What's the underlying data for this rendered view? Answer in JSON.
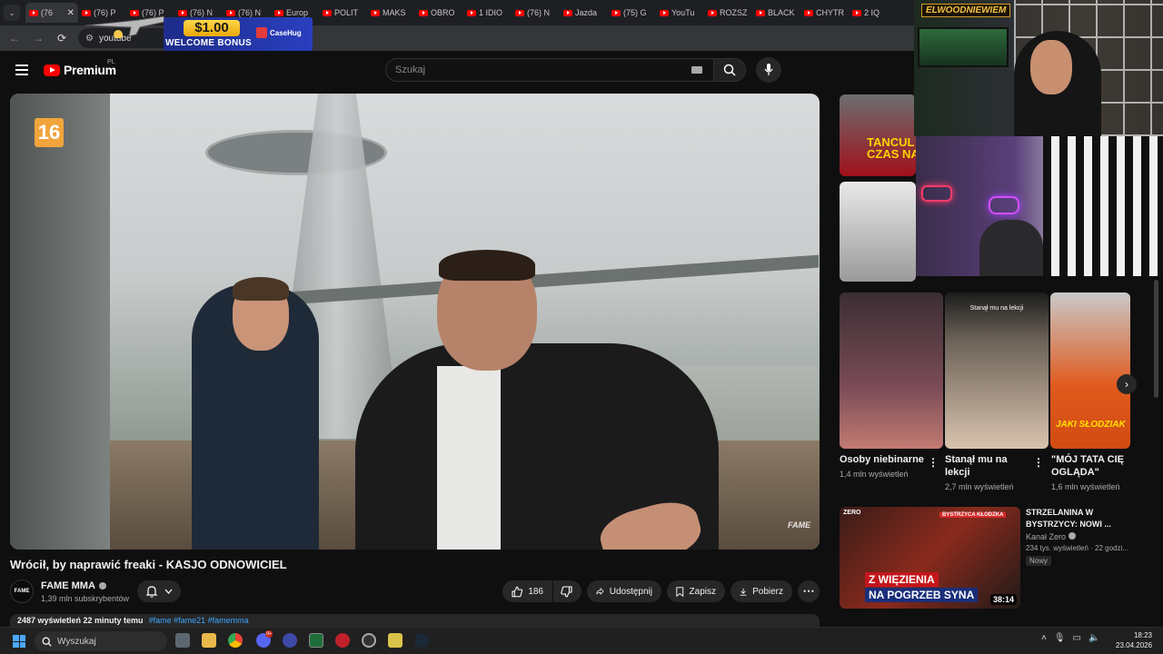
{
  "browser": {
    "tabs": [
      {
        "label": "(76",
        "active": true
      },
      {
        "label": "(76) P"
      },
      {
        "label": "(76) P"
      },
      {
        "label": "(76) N"
      },
      {
        "label": "(76) N"
      },
      {
        "label": "Europ"
      },
      {
        "label": "POLIT"
      },
      {
        "label": "MAKS"
      },
      {
        "label": "OBRO"
      },
      {
        "label": "1 IDIO"
      },
      {
        "label": "(76) N"
      },
      {
        "label": "Jazda"
      },
      {
        "label": "(75) G"
      },
      {
        "label": "YouTu"
      },
      {
        "label": "ROZSZ"
      },
      {
        "label": "BLACK"
      },
      {
        "label": "CHYTR"
      },
      {
        "label": "2 IQ"
      }
    ],
    "close_glyph": "✕",
    "tab_list_glyph": "⌄",
    "address": "youtube"
  },
  "ad": {
    "amount": "$1.00",
    "bonus_text": "WELCOME BONUS",
    "brand": "CaseHug"
  },
  "youtube": {
    "logo_text": "Premium",
    "country_code": "PL",
    "search_placeholder": "Szukaj"
  },
  "video": {
    "age_rating": "16",
    "watermark": "FAME",
    "title": "Wrócił, by naprawić freaki - KASJO ODNOWICIEL",
    "channel_name": "FAME MMA",
    "channel_avatar_text": "FAME",
    "subscribers": "1,39 mln subskrybentów",
    "likes": "186",
    "share_label": "Udostępnij",
    "save_label": "Zapisz",
    "download_label": "Pobierz",
    "views_line": "2487 wyświetleń  22 minuty temu",
    "tags": "#fame #fame21 #famemma"
  },
  "sidebar": {
    "top_thumb_text": "TANCUL\nCZAS NA",
    "shorts": [
      {
        "title": "Osoby niebinarne",
        "views": "1,4 mln wyświetleń",
        "caption": ""
      },
      {
        "title": "Stanął mu na lekcji",
        "views": "2,7 mln wyświetleń",
        "caption": "Stanął mu na lekcji"
      },
      {
        "title": "\"MÓJ TATA CIĘ OGLĄDA\"",
        "views": "1,6 mln wyświetleń",
        "caption": "JAKI SŁODZIAK"
      }
    ],
    "recommended": {
      "thumb_line1": "Z WIĘZIENIA",
      "thumb_line2": "NA POGRZEB SYNA",
      "thumb_logo": "ZERO",
      "thumb_region": "BYSTRZYCA KŁODZKA",
      "duration": "38:14",
      "title": "STRZELANINA W BYSTRZYCY: NOWI ...",
      "channel": "Kanał Zero",
      "meta": "234 tys. wyświetleń · 22 godzi...",
      "badge": "Nowy"
    }
  },
  "stream": {
    "logo": "ELWOODNIEWIEM"
  },
  "taskbar": {
    "search_label": "Wyszukaj",
    "time": "18:23",
    "date": "23.04.2026",
    "discord_badge": "9+"
  }
}
